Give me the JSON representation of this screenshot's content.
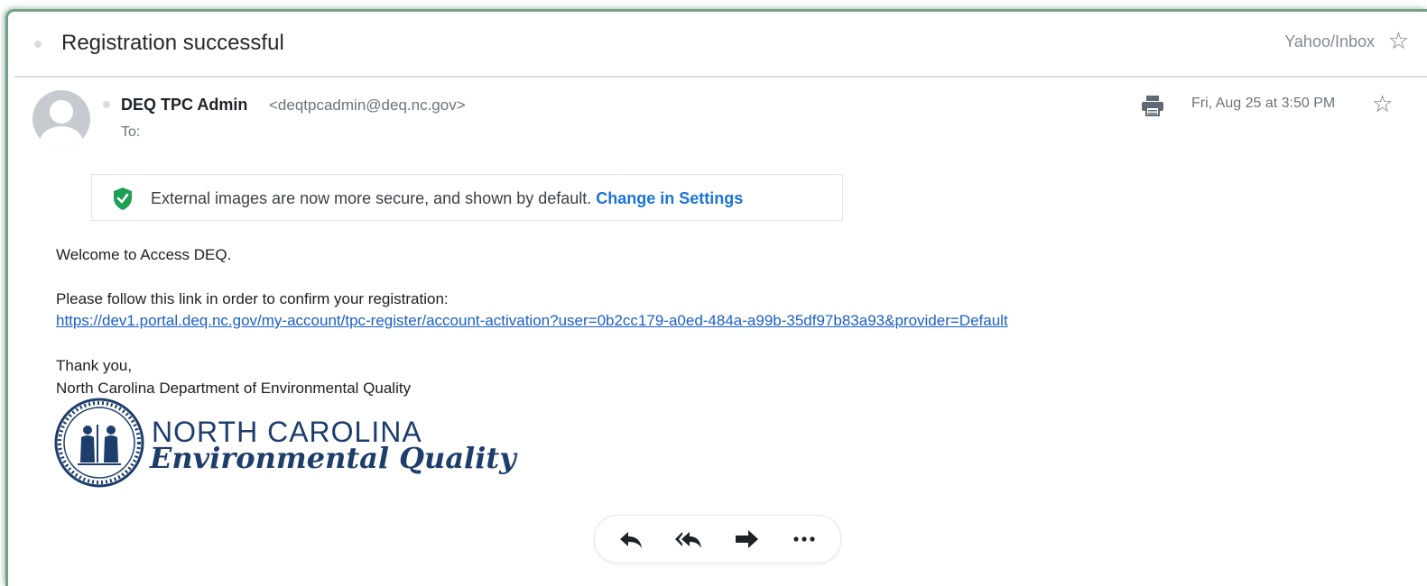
{
  "email": {
    "subject": "Registration successful",
    "folder": "Yahoo/Inbox",
    "sender_name": "DEQ TPC Admin",
    "sender_email": "<deqtpcadmin@deq.nc.gov>",
    "to_label": "To:",
    "date": "Fri, Aug 25 at 3:50 PM"
  },
  "notice": {
    "text": "External images are now more secure, and shown by default.",
    "link": "Change in Settings"
  },
  "body": {
    "welcome": "Welcome to Access DEQ.",
    "instruction": "Please follow this link in order to confirm your registration:",
    "link": "https://dev1.portal.deq.nc.gov/my-account/tpc-register/account-activation?user=0b2cc179-a0ed-484a-a99b-35df97b83a93&provider=Default",
    "thanks": "Thank you,",
    "signature": "North Carolina Department of Environmental Quality"
  },
  "logo": {
    "line1": "NORTH CAROLINA",
    "line2": "Environmental Quality"
  },
  "actions": {
    "reply_icon": "reply-icon",
    "reply_all_icon": "reply-all-icon",
    "forward_icon": "forward-icon",
    "more_icon": "more-icon"
  },
  "colors": {
    "frame": "#6fa287",
    "link": "#1a5fcc",
    "notice_link": "#1a73d9",
    "shield": "#1e9e53",
    "logo": "#1d3d6b"
  }
}
